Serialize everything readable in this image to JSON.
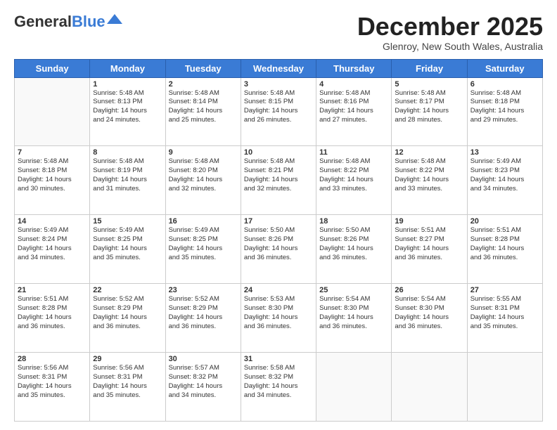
{
  "header": {
    "logo_general": "General",
    "logo_blue": "Blue",
    "month_title": "December 2025",
    "location": "Glenroy, New South Wales, Australia"
  },
  "calendar": {
    "days": [
      "Sunday",
      "Monday",
      "Tuesday",
      "Wednesday",
      "Thursday",
      "Friday",
      "Saturday"
    ],
    "weeks": [
      [
        {
          "day": "",
          "content": ""
        },
        {
          "day": "1",
          "content": "Sunrise: 5:48 AM\nSunset: 8:13 PM\nDaylight: 14 hours\nand 24 minutes."
        },
        {
          "day": "2",
          "content": "Sunrise: 5:48 AM\nSunset: 8:14 PM\nDaylight: 14 hours\nand 25 minutes."
        },
        {
          "day": "3",
          "content": "Sunrise: 5:48 AM\nSunset: 8:15 PM\nDaylight: 14 hours\nand 26 minutes."
        },
        {
          "day": "4",
          "content": "Sunrise: 5:48 AM\nSunset: 8:16 PM\nDaylight: 14 hours\nand 27 minutes."
        },
        {
          "day": "5",
          "content": "Sunrise: 5:48 AM\nSunset: 8:17 PM\nDaylight: 14 hours\nand 28 minutes."
        },
        {
          "day": "6",
          "content": "Sunrise: 5:48 AM\nSunset: 8:18 PM\nDaylight: 14 hours\nand 29 minutes."
        }
      ],
      [
        {
          "day": "7",
          "content": "Sunrise: 5:48 AM\nSunset: 8:18 PM\nDaylight: 14 hours\nand 30 minutes."
        },
        {
          "day": "8",
          "content": "Sunrise: 5:48 AM\nSunset: 8:19 PM\nDaylight: 14 hours\nand 31 minutes."
        },
        {
          "day": "9",
          "content": "Sunrise: 5:48 AM\nSunset: 8:20 PM\nDaylight: 14 hours\nand 32 minutes."
        },
        {
          "day": "10",
          "content": "Sunrise: 5:48 AM\nSunset: 8:21 PM\nDaylight: 14 hours\nand 32 minutes."
        },
        {
          "day": "11",
          "content": "Sunrise: 5:48 AM\nSunset: 8:22 PM\nDaylight: 14 hours\nand 33 minutes."
        },
        {
          "day": "12",
          "content": "Sunrise: 5:48 AM\nSunset: 8:22 PM\nDaylight: 14 hours\nand 33 minutes."
        },
        {
          "day": "13",
          "content": "Sunrise: 5:49 AM\nSunset: 8:23 PM\nDaylight: 14 hours\nand 34 minutes."
        }
      ],
      [
        {
          "day": "14",
          "content": "Sunrise: 5:49 AM\nSunset: 8:24 PM\nDaylight: 14 hours\nand 34 minutes."
        },
        {
          "day": "15",
          "content": "Sunrise: 5:49 AM\nSunset: 8:25 PM\nDaylight: 14 hours\nand 35 minutes."
        },
        {
          "day": "16",
          "content": "Sunrise: 5:49 AM\nSunset: 8:25 PM\nDaylight: 14 hours\nand 35 minutes."
        },
        {
          "day": "17",
          "content": "Sunrise: 5:50 AM\nSunset: 8:26 PM\nDaylight: 14 hours\nand 36 minutes."
        },
        {
          "day": "18",
          "content": "Sunrise: 5:50 AM\nSunset: 8:26 PM\nDaylight: 14 hours\nand 36 minutes."
        },
        {
          "day": "19",
          "content": "Sunrise: 5:51 AM\nSunset: 8:27 PM\nDaylight: 14 hours\nand 36 minutes."
        },
        {
          "day": "20",
          "content": "Sunrise: 5:51 AM\nSunset: 8:28 PM\nDaylight: 14 hours\nand 36 minutes."
        }
      ],
      [
        {
          "day": "21",
          "content": "Sunrise: 5:51 AM\nSunset: 8:28 PM\nDaylight: 14 hours\nand 36 minutes."
        },
        {
          "day": "22",
          "content": "Sunrise: 5:52 AM\nSunset: 8:29 PM\nDaylight: 14 hours\nand 36 minutes."
        },
        {
          "day": "23",
          "content": "Sunrise: 5:52 AM\nSunset: 8:29 PM\nDaylight: 14 hours\nand 36 minutes."
        },
        {
          "day": "24",
          "content": "Sunrise: 5:53 AM\nSunset: 8:30 PM\nDaylight: 14 hours\nand 36 minutes."
        },
        {
          "day": "25",
          "content": "Sunrise: 5:54 AM\nSunset: 8:30 PM\nDaylight: 14 hours\nand 36 minutes."
        },
        {
          "day": "26",
          "content": "Sunrise: 5:54 AM\nSunset: 8:30 PM\nDaylight: 14 hours\nand 36 minutes."
        },
        {
          "day": "27",
          "content": "Sunrise: 5:55 AM\nSunset: 8:31 PM\nDaylight: 14 hours\nand 35 minutes."
        }
      ],
      [
        {
          "day": "28",
          "content": "Sunrise: 5:56 AM\nSunset: 8:31 PM\nDaylight: 14 hours\nand 35 minutes."
        },
        {
          "day": "29",
          "content": "Sunrise: 5:56 AM\nSunset: 8:31 PM\nDaylight: 14 hours\nand 35 minutes."
        },
        {
          "day": "30",
          "content": "Sunrise: 5:57 AM\nSunset: 8:32 PM\nDaylight: 14 hours\nand 34 minutes."
        },
        {
          "day": "31",
          "content": "Sunrise: 5:58 AM\nSunset: 8:32 PM\nDaylight: 14 hours\nand 34 minutes."
        },
        {
          "day": "",
          "content": ""
        },
        {
          "day": "",
          "content": ""
        },
        {
          "day": "",
          "content": ""
        }
      ]
    ]
  }
}
